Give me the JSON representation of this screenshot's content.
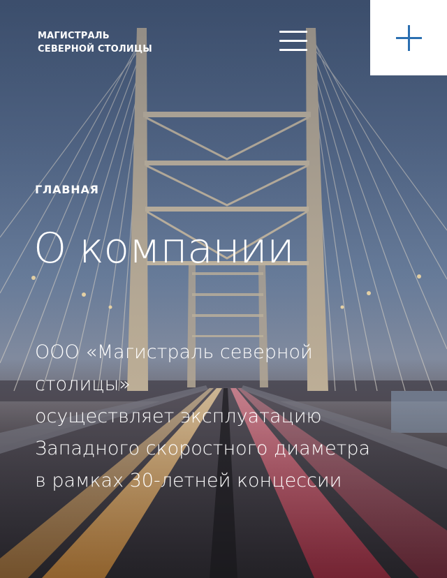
{
  "header": {
    "logo_line1": "МАГИСТРАЛЬ",
    "logo_line2": "СЕВЕРНОЙ СТОЛИЦЫ",
    "menu_icon": "hamburger-menu-icon",
    "plus_icon": "plus-icon"
  },
  "breadcrumb": "ГЛАВНАЯ",
  "title": "О компании",
  "description": {
    "line1": "ООО «Магистраль северной",
    "line2": "столицы»",
    "line3": "осуществляет эксплуатацию",
    "line4": "Западного скоростного диаметра",
    "line5": "в рамках 30-летней концессии"
  },
  "colors": {
    "accent": "#2b6fb1",
    "text": "#ffffff",
    "sky": "#5a6f8f"
  }
}
